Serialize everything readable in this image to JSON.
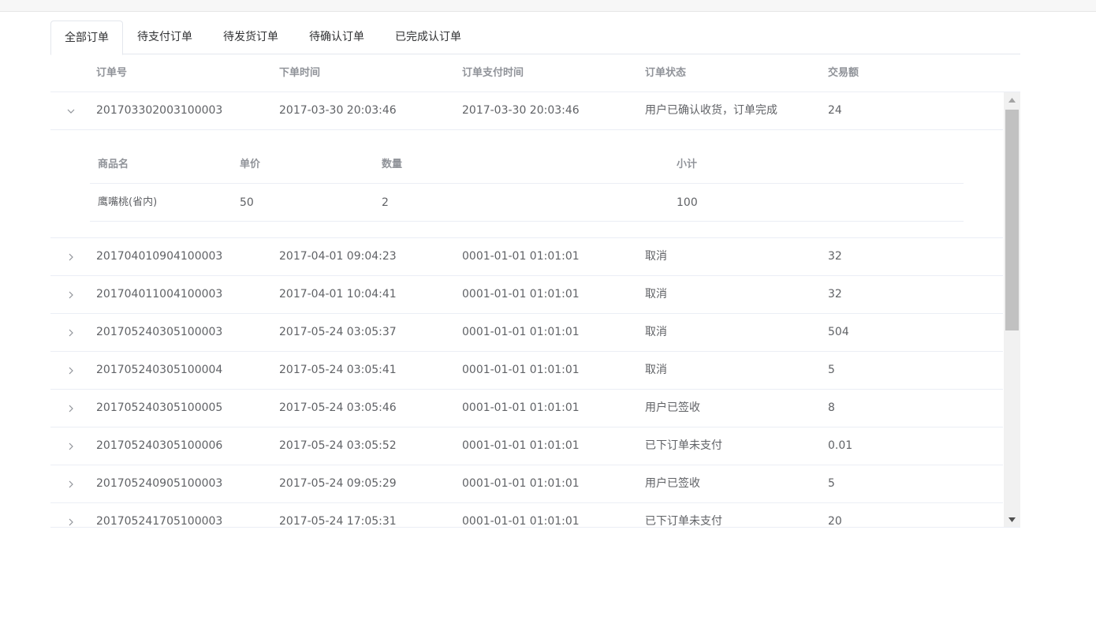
{
  "tabs": [
    "全部订单",
    "待支付订单",
    "待发货订单",
    "待确认订单",
    "已完成认订单"
  ],
  "columns": {
    "order_no": "订单号",
    "order_time": "下单时间",
    "pay_time": "订单支付时间",
    "status": "订单状态",
    "amount": "交易额"
  },
  "orders": [
    {
      "order_no": "201703302003100003",
      "order_time": "2017-03-30 20:03:46",
      "pay_time": "2017-03-30 20:03:46",
      "status": "用户已确认收货，订单完成",
      "amount": "24",
      "expanded": true
    },
    {
      "order_no": "201704010904100003",
      "order_time": "2017-04-01 09:04:23",
      "pay_time": "0001-01-01 01:01:01",
      "status": "取消",
      "amount": "32"
    },
    {
      "order_no": "201704011004100003",
      "order_time": "2017-04-01 10:04:41",
      "pay_time": "0001-01-01 01:01:01",
      "status": "取消",
      "amount": "32"
    },
    {
      "order_no": "201705240305100003",
      "order_time": "2017-05-24 03:05:37",
      "pay_time": "0001-01-01 01:01:01",
      "status": "取消",
      "amount": "504"
    },
    {
      "order_no": "201705240305100004",
      "order_time": "2017-05-24 03:05:41",
      "pay_time": "0001-01-01 01:01:01",
      "status": "取消",
      "amount": "5"
    },
    {
      "order_no": "201705240305100005",
      "order_time": "2017-05-24 03:05:46",
      "pay_time": "0001-01-01 01:01:01",
      "status": "用户已签收",
      "amount": "8"
    },
    {
      "order_no": "201705240305100006",
      "order_time": "2017-05-24 03:05:52",
      "pay_time": "0001-01-01 01:01:01",
      "status": "已下订单未支付",
      "amount": "0.01"
    },
    {
      "order_no": "201705240905100003",
      "order_time": "2017-05-24 09:05:29",
      "pay_time": "0001-01-01 01:01:01",
      "status": "用户已签收",
      "amount": "5"
    },
    {
      "order_no": "201705241705100003",
      "order_time": "2017-05-24 17:05:31",
      "pay_time": "0001-01-01 01:01:01",
      "status": "已下订单未支付",
      "amount": "20"
    }
  ],
  "detail": {
    "columns": {
      "name": "商品名",
      "price": "单价",
      "qty": "数量",
      "subtotal": "小计"
    },
    "items": [
      {
        "name": "鹰嘴桃(省内)",
        "price": "50",
        "qty": "2",
        "subtotal": "100"
      }
    ]
  },
  "colors": {
    "border": "#ebeef5",
    "header_text": "#909399",
    "cell_text": "#606266",
    "scroll_thumb": "#c1c1c1"
  },
  "icons": {
    "row_toggle_collapsed": "chevron-right-icon",
    "row_toggle_expanded": "chevron-down-icon",
    "scroll_up": "triangle-up-icon",
    "scroll_down": "triangle-down-icon"
  }
}
